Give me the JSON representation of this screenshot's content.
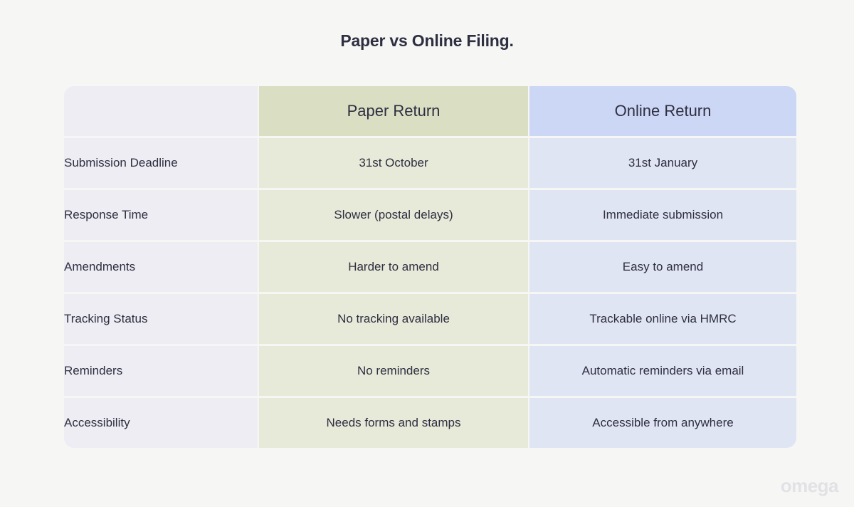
{
  "page": {
    "title": "Paper vs Online Filing.",
    "background_color": "#f6f6f5",
    "text_color": "#2e2f40",
    "watermark": "omega"
  },
  "table": {
    "columns": [
      {
        "key": "label",
        "header": "",
        "background": "#eeedf4",
        "header_background": "#eeedf4",
        "align": "left"
      },
      {
        "key": "paper",
        "header": "Paper Return",
        "background": "#e7e9d9",
        "header_background": "#dadfc4",
        "align": "center"
      },
      {
        "key": "online",
        "header": "Online Return",
        "background": "#e0e5f4",
        "header_background": "#ccd7f5",
        "align": "center"
      }
    ],
    "rows": [
      {
        "label": "Submission Deadline",
        "paper": "31st October",
        "online": "31st January"
      },
      {
        "label": "Response Time",
        "paper": "Slower (postal delays)",
        "online": "Immediate submission"
      },
      {
        "label": "Amendments",
        "paper": "Harder to amend",
        "online": "Easy to amend"
      },
      {
        "label": "Tracking Status",
        "paper": "No tracking available",
        "online": "Trackable online via HMRC"
      },
      {
        "label": "Reminders",
        "paper": "No reminders",
        "online": "Automatic reminders via email"
      },
      {
        "label": "Accessibility",
        "paper": "Needs forms and stamps",
        "online": "Accessible from anywhere"
      }
    ]
  }
}
